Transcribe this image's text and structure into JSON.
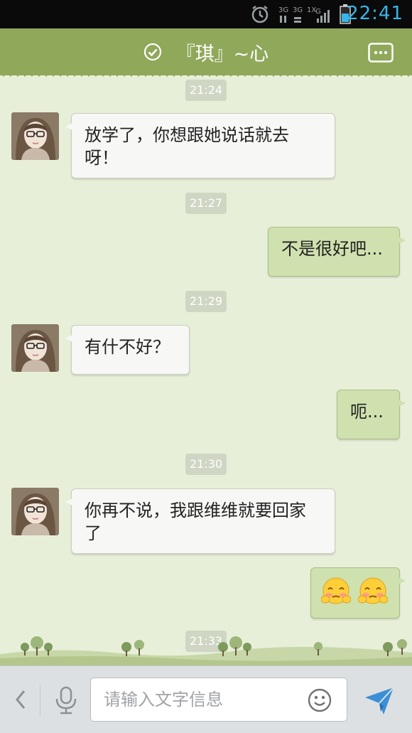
{
  "status_bar": {
    "time": "22:41",
    "network_label": "3G",
    "icons": [
      "alarm-icon",
      "signal-icon",
      "battery-icon"
    ]
  },
  "header": {
    "title": "『琪』~心",
    "icons": [
      "check-circle-icon",
      "more-menu-icon"
    ]
  },
  "messages": [
    {
      "type": "timestamp",
      "text": "21:24"
    },
    {
      "type": "incoming",
      "text": "放学了，你想跟她说话就去呀！"
    },
    {
      "type": "timestamp",
      "text": "21:27"
    },
    {
      "type": "outgoing",
      "text": "不是很好吧..."
    },
    {
      "type": "timestamp",
      "text": "21:29"
    },
    {
      "type": "incoming",
      "text": "有什不好？"
    },
    {
      "type": "outgoing",
      "text": "呃..."
    },
    {
      "type": "timestamp",
      "text": "21:30"
    },
    {
      "type": "incoming",
      "text": "你再不说，我跟维维就要回家了"
    },
    {
      "type": "outgoing",
      "emoji": [
        "blush-emoji",
        "blush-emoji"
      ]
    },
    {
      "type": "timestamp",
      "text": "21:33"
    }
  ],
  "input_bar": {
    "placeholder": "请输入文字信息",
    "icons": [
      "back-chevron-icon",
      "microphone-icon",
      "smiley-icon",
      "send-icon"
    ]
  },
  "colors": {
    "header": "#8fa85a",
    "chat_background": "#e7efd9",
    "incoming_bubble": "#f7f7f5",
    "outgoing_bubble": "#cfe1ae",
    "status_time": "#37b6e8"
  }
}
